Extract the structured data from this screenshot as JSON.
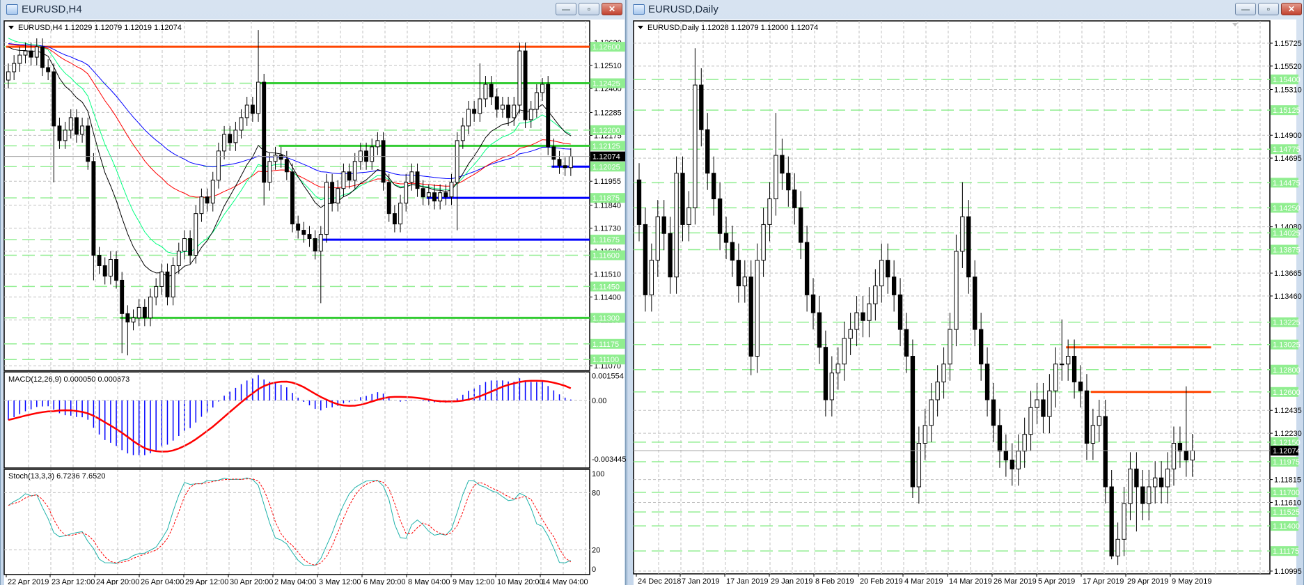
{
  "left": {
    "title": "EURUSD,H4",
    "header": "EURUSD,H4  1.12029 1.12079 1.12019 1.12074",
    "buttons": {
      "minimize": "—",
      "restore": "▫",
      "close": "✕"
    },
    "price_ticks": [
      "1.12620",
      "1.12510",
      "1.12400",
      "1.12285",
      "1.12175",
      "1.11955",
      "1.11840",
      "1.11730",
      "1.11620",
      "1.11510",
      "1.11400",
      "1.11290",
      "1.11070"
    ],
    "levels": [
      "1.12600",
      "1.12425",
      "1.12200",
      "1.12125",
      "1.12025",
      "1.11875",
      "1.11675",
      "1.11600",
      "1.11450",
      "1.11300",
      "1.11175",
      "1.11100"
    ],
    "current": "1.12074",
    "lines": [
      {
        "price": 1.126,
        "color": "#ff4500",
        "from_bar": 0
      },
      {
        "price": 1.12425,
        "color": "#33cc33",
        "from_bar": 44
      },
      {
        "price": 1.12125,
        "color": "#33cc33",
        "from_bar": 48
      },
      {
        "price": 1.113,
        "color": "#33cc33",
        "from_bar": 20
      },
      {
        "price": 1.12025,
        "color": "#0000ff",
        "from_bar": 96
      },
      {
        "price": 1.11875,
        "color": "#0000ff",
        "from_bar": 74
      },
      {
        "price": 1.11675,
        "color": "#0000ff",
        "from_bar": 55
      }
    ],
    "first_open": 1.1244,
    "wick": 0.0004,
    "closes": [
      1.1248,
      1.1252,
      1.1256,
      1.1258,
      1.1255,
      1.126,
      1.125,
      1.1248,
      1.1222,
      1.1215,
      1.122,
      1.1226,
      1.1218,
      1.1222,
      1.1205,
      1.116,
      1.1155,
      1.115,
      1.1158,
      1.1148,
      1.1132,
      1.1128,
      1.113,
      1.1135,
      1.113,
      1.114,
      1.1145,
      1.1152,
      1.114,
      1.1155,
      1.1162,
      1.1168,
      1.116,
      1.118,
      1.1188,
      1.1185,
      1.1196,
      1.121,
      1.1218,
      1.1214,
      1.122,
      1.1226,
      1.1232,
      1.1228,
      1.1243,
      1.1195,
      1.1205,
      1.1208,
      1.1206,
      1.12,
      1.1175,
      1.1172,
      1.117,
      1.1168,
      1.1162,
      1.117,
      1.1195,
      1.1185,
      1.1192,
      1.12,
      1.1196,
      1.1205,
      1.121,
      1.1205,
      1.1212,
      1.1215,
      1.1195,
      1.118,
      1.1175,
      1.1185,
      1.1195,
      1.12,
      1.1192,
      1.1188,
      1.119,
      1.1186,
      1.119,
      1.1188,
      1.1195,
      1.1215,
      1.1222,
      1.123,
      1.1228,
      1.1235,
      1.1242,
      1.1236,
      1.123,
      1.1232,
      1.1226,
      1.1232,
      1.1258,
      1.1225,
      1.123,
      1.1238,
      1.1242,
      1.1212,
      1.1206,
      1.1203,
      1.1202,
      1.12074
    ],
    "spikes": {
      "8": {
        "l": 1.1195
      },
      "15": {
        "l": 1.1148
      },
      "20": {
        "l": 1.1113
      },
      "21": {
        "l": 1.1112
      },
      "44": {
        "h": 1.1268
      },
      "45": {
        "l": 1.1184
      },
      "55": {
        "l": 1.1137
      },
      "79": {
        "l": 1.1172
      },
      "83": {
        "h": 1.1252
      },
      "90": {
        "h": 1.1262
      },
      "94": {
        "h": 1.1245
      }
    },
    "mas": [
      {
        "name": "ma-blue",
        "color": "#0000ff",
        "period": 60,
        "start": 1.1262
      },
      {
        "name": "ma-red",
        "color": "#ff0000",
        "period": 40,
        "start": 1.1262
      },
      {
        "name": "ma-green",
        "color": "#00ff7f",
        "period": 18,
        "start": 1.1266
      },
      {
        "name": "ma-black",
        "color": "#000000",
        "period": 12,
        "start": 1.1262
      }
    ],
    "macd": {
      "label": "MACD(12,26,9) 0.000050 0.000673",
      "ticks": [
        "0.001554",
        "0.00",
        "-0.003445"
      ],
      "hist_color": "#0000ff",
      "signal_color": "#ff0000"
    },
    "stoch": {
      "label": "Stoch(13,3,3) 6.7236 7.6520",
      "ticks": [
        "100",
        "80",
        "20",
        "0"
      ],
      "main_color": "#20b2aa",
      "signal_color": "#ff0000"
    },
    "dates": [
      "22 Apr 2019",
      "23 Apr 12:00",
      "24 Apr 20:00",
      "26 Apr 04:00",
      "29 Apr 12:00",
      "30 Apr 20:00",
      "2 May 04:00",
      "3 May 12:00",
      "6 May 20:00",
      "8 May 04:00",
      "9 May 12:00",
      "10 May 20:00",
      "14 May 04:00"
    ]
  },
  "right": {
    "title": "EURUSD,Daily",
    "header": "EURUSD,Daily  1.12028 1.12079 1.12000 1.12074",
    "buttons": {
      "minimize": "—",
      "restore": "▫",
      "close": "✕"
    },
    "price_ticks": [
      "1.15725",
      "1.15520",
      "1.15310",
      "1.14900",
      "1.14695",
      "1.14080",
      "1.13665",
      "1.13460",
      "1.12435",
      "1.12230",
      "1.11815",
      "1.11610",
      "1.10995"
    ],
    "levels": [
      "1.15400",
      "1.15125",
      "1.14775",
      "1.14475",
      "1.14250",
      "1.14025",
      "1.13875",
      "1.13225",
      "1.13025",
      "1.12800",
      "1.12600",
      "1.12150",
      "1.11975",
      "1.11700",
      "1.11525",
      "1.11400",
      "1.11175"
    ],
    "current": "1.12074",
    "lines": [
      {
        "price": 1.13,
        "color": "#ff4500",
        "from_bar": 69,
        "to_bar": 92
      },
      {
        "price": 1.126,
        "color": "#ff4500",
        "from_bar": 73,
        "to_bar": 92
      }
    ],
    "first_open": 1.145,
    "wick": 0.0015,
    "closes": [
      1.141,
      1.1347,
      1.1378,
      1.1417,
      1.1402,
      1.1363,
      1.1456,
      1.141,
      1.1425,
      1.1535,
      1.1495,
      1.1456,
      1.1433,
      1.1402,
      1.1394,
      1.1378,
      1.1355,
      1.1363,
      1.1292,
      1.1378,
      1.141,
      1.1433,
      1.1472,
      1.1456,
      1.1441,
      1.1425,
      1.1394,
      1.1347,
      1.1331,
      1.13,
      1.1253,
      1.1277,
      1.1285,
      1.1308,
      1.1316,
      1.1331,
      1.1324,
      1.1339,
      1.1355,
      1.1378,
      1.1363,
      1.1347,
      1.1316,
      1.1292,
      1.1175,
      1.1214,
      1.123,
      1.1253,
      1.1269,
      1.1285,
      1.1316,
      1.1386,
      1.1417,
      1.1363,
      1.1316,
      1.1285,
      1.1253,
      1.123,
      1.1207,
      1.1199,
      1.1191,
      1.1207,
      1.1222,
      1.1246,
      1.1253,
      1.1238,
      1.1261,
      1.1285,
      1.1285,
      1.1292,
      1.1269,
      1.1261,
      1.1214,
      1.123,
      1.1238,
      1.1175,
      1.1113,
      1.1128,
      1.116,
      1.1191,
      1.1175,
      1.116,
      1.1175,
      1.1183,
      1.1175,
      1.1191,
      1.1214,
      1.1207,
      1.1199,
      1.12074
    ],
    "spikes": {
      "9": {
        "h": 1.1568
      },
      "10": {
        "h": 1.155
      },
      "18": {
        "l": 1.1275
      },
      "22": {
        "h": 1.151
      },
      "44": {
        "l": 1.1165
      },
      "52": {
        "h": 1.1448
      },
      "68": {
        "h": 1.1325
      },
      "76": {
        "l": 1.111
      },
      "77": {
        "l": 1.1105
      },
      "80": {
        "l": 1.1135
      },
      "88": {
        "h": 1.1265
      }
    },
    "dates": [
      "24 Dec 2018",
      "7 Jan 2019",
      "17 Jan 2019",
      "29 Jan 2019",
      "8 Feb 2019",
      "20 Feb 2019",
      "4 Mar 2019",
      "14 Mar 2019",
      "26 Mar 2019",
      "5 Apr 2019",
      "17 Apr 2019",
      "29 Apr 2019",
      "9 May 2019"
    ]
  },
  "colors": {
    "level_line": "#90ee90",
    "grid": "#c0c0c0",
    "bull_body": "#ffffff",
    "bear_body": "#000000"
  }
}
